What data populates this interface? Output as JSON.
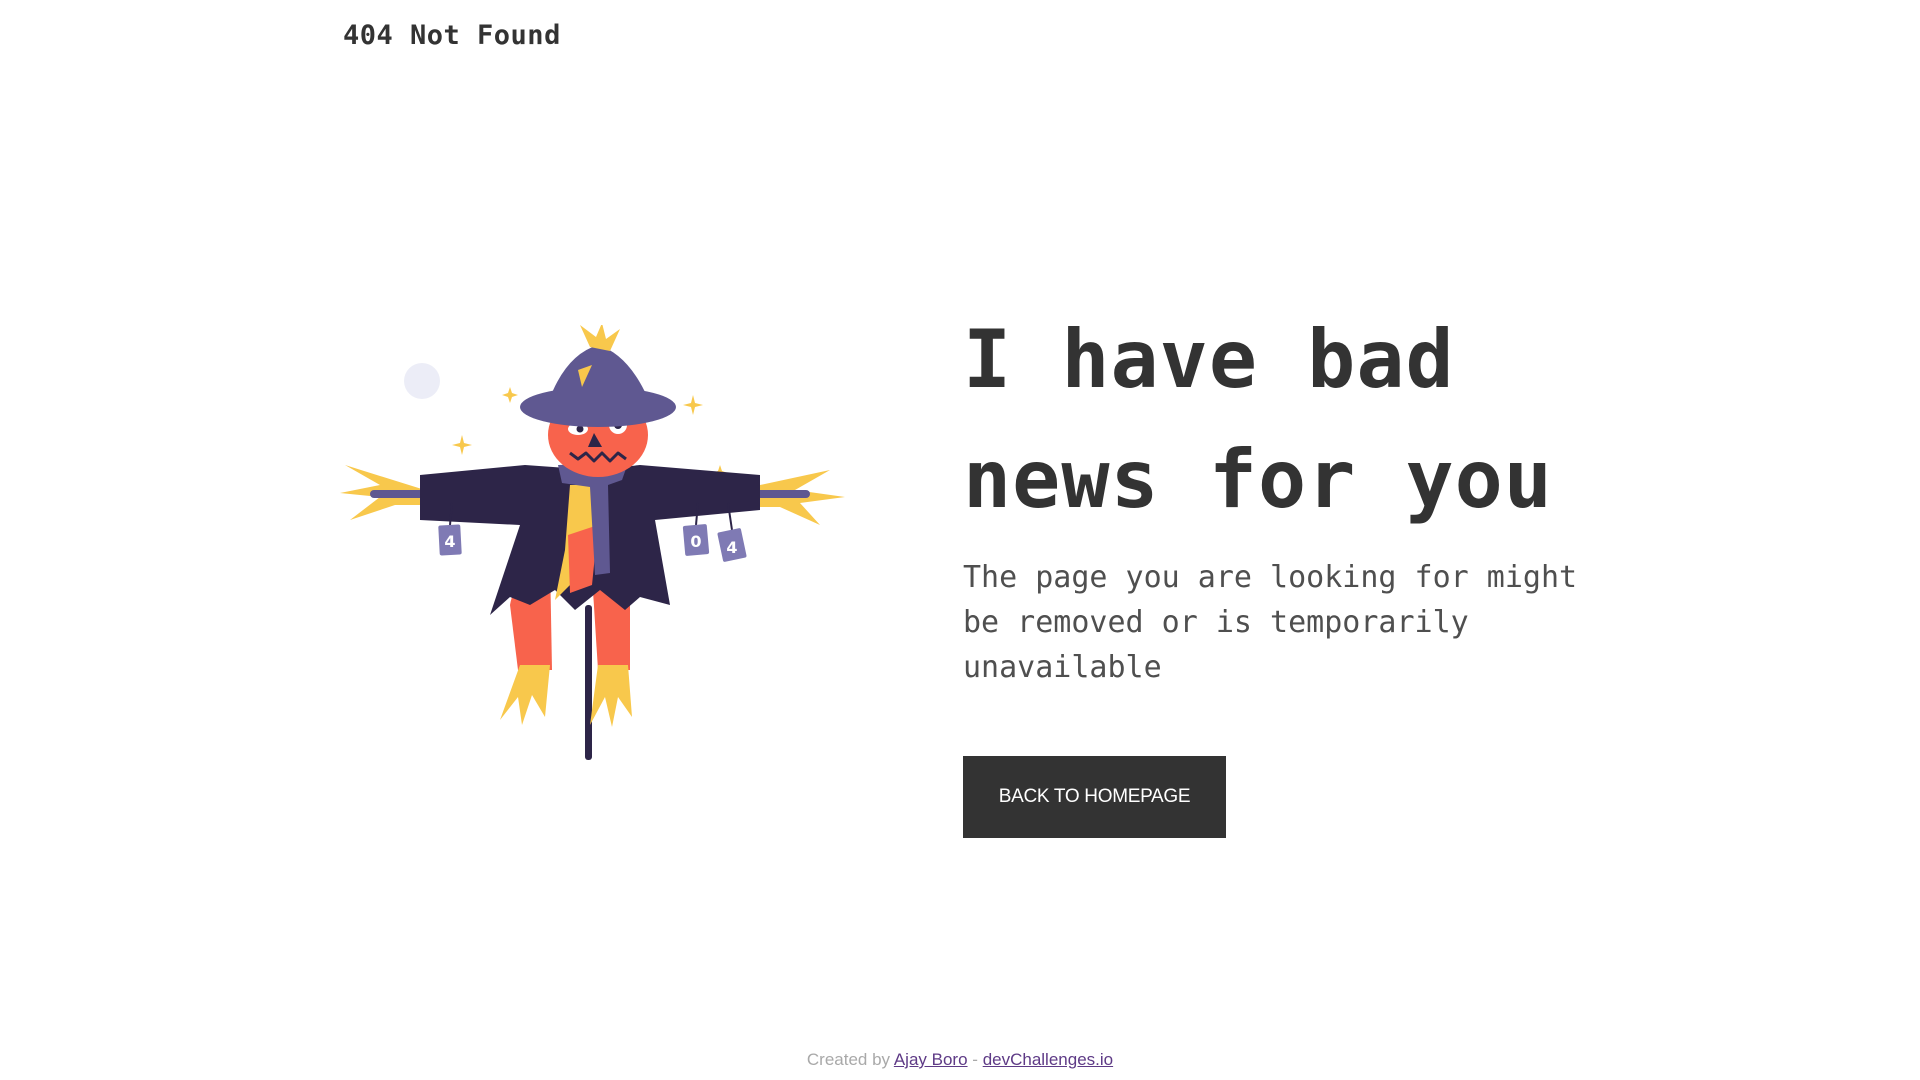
{
  "header": {
    "title": "404 Not Found"
  },
  "illustration": {
    "icon": "scarecrow-illustration",
    "can_labels": [
      "4",
      "0",
      "4"
    ],
    "colors": {
      "hat": "#5f5891",
      "coat": "#2d2548",
      "face": "#f8634c",
      "straw": "#f8c84c",
      "moon": "#ecedf7"
    }
  },
  "main": {
    "headline": "I have bad news for you",
    "description": "The page you are looking for might be removed or is temporarily unavailable",
    "button_label": "BACK TO HOMEPAGE"
  },
  "footer": {
    "prefix": "Created by",
    "author": "Ajay Boro",
    "separator": "-",
    "site": "devChallenges.io"
  },
  "colors": {
    "text": "#333333",
    "button_bg": "#333333",
    "button_text": "#ffffff",
    "link": "#5e3a86",
    "footer_text": "#a9a9a9"
  }
}
